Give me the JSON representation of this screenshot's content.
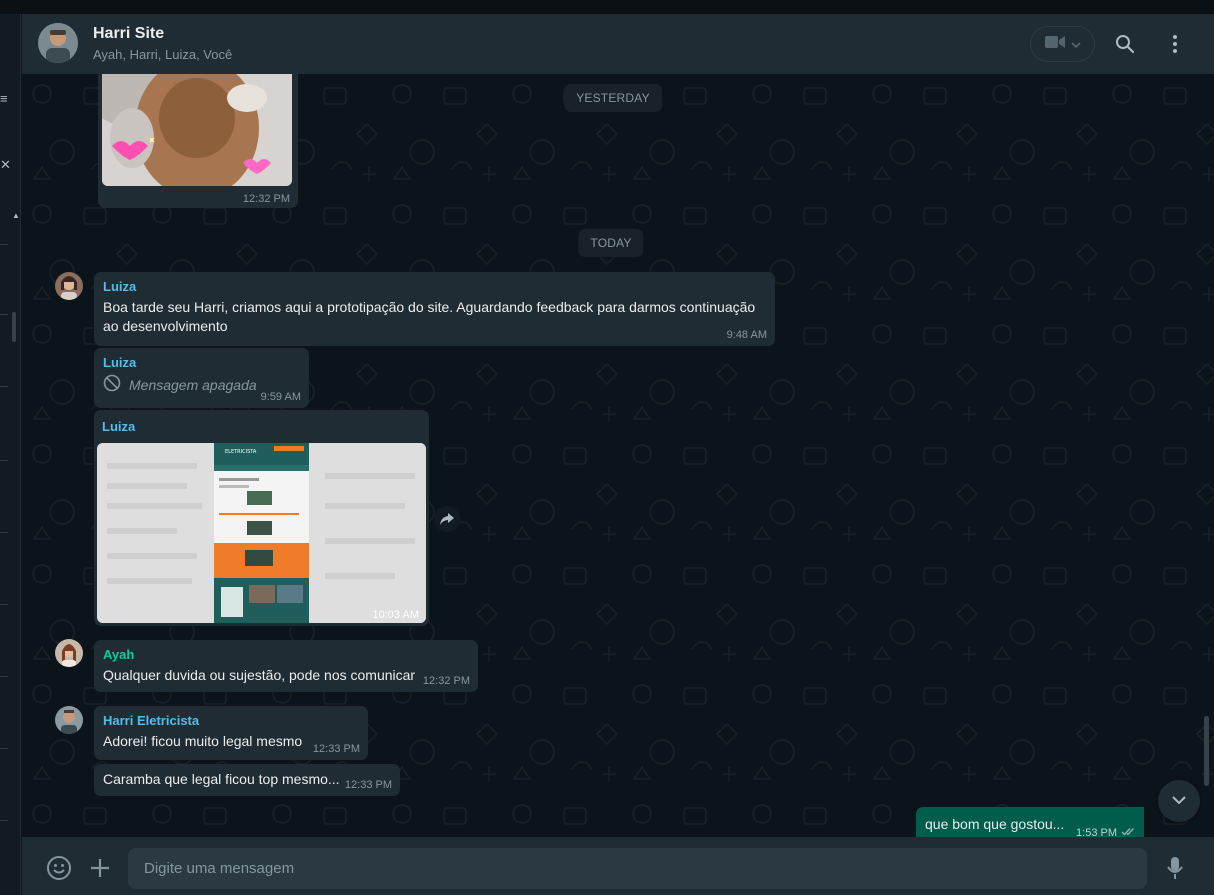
{
  "header": {
    "title": "Harri Site",
    "subtitle": "Ayah, Harri, Luiza, Você"
  },
  "dividers": {
    "yesterday": "YESTERDAY",
    "today": "TODAY"
  },
  "messages": [
    {
      "type": "image",
      "time": "12:32 PM"
    },
    {
      "sender": "Luiza",
      "text_line1": "Boa tarde seu Harri, criamos aqui a prototipação do site. Aguardando feedback para darmos continuação",
      "text_line2": "ao desenvolvimento",
      "time": "9:48 AM"
    },
    {
      "sender": "Luiza",
      "text": "Mensagem apagada",
      "time": "9:59 AM"
    },
    {
      "sender": "Luiza",
      "type": "image",
      "time": "10:03 AM",
      "image_heading": "ELETRICISTA"
    },
    {
      "sender": "Ayah",
      "text": "Qualquer duvida ou sujestão, pode nos comunicar",
      "time": "12:32 PM"
    },
    {
      "sender": "Harri Eletricista",
      "text": "Adorei! ficou muito legal mesmo",
      "time": "12:33 PM"
    },
    {
      "text": "Caramba que legal ficou top mesmo...",
      "time": "12:33 PM"
    },
    {
      "text": "que bom que gostou...",
      "time": "1:53 PM"
    }
  ],
  "composer": {
    "placeholder": "Digite uma mensagem"
  },
  "colors": {
    "background": "#0b141a",
    "panel": "#202c33",
    "incoming": "#202c33",
    "outgoing": "#005c4b",
    "sender_luiza": "#53bdeb",
    "sender_ayah": "#06cf9c",
    "sender_harri": "#53bdeb"
  },
  "icons": [
    "video-icon",
    "chevron-down-icon",
    "search-icon",
    "menu-icon",
    "forward-icon",
    "deleted-icon",
    "emoji-icon",
    "plus-icon",
    "mic-icon",
    "read-ticks-icon"
  ]
}
